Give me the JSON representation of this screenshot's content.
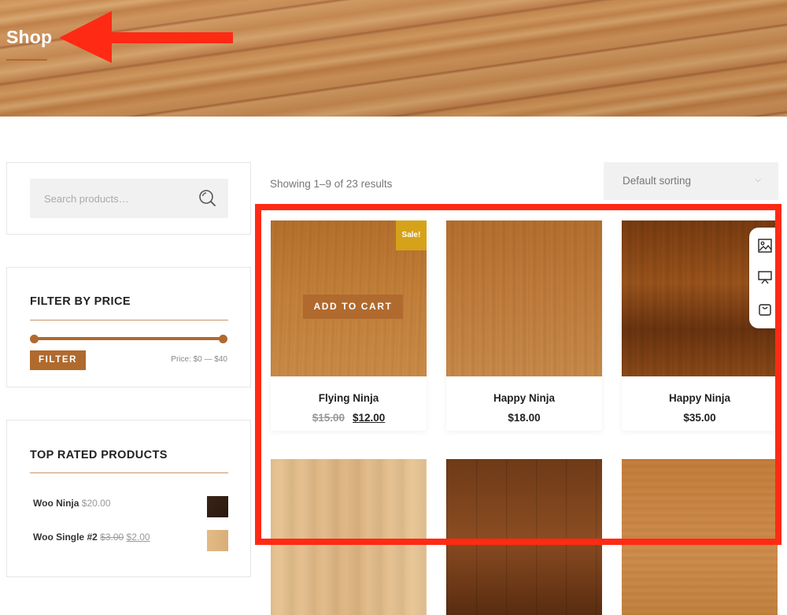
{
  "hero": {
    "title": "Shop"
  },
  "search": {
    "placeholder": "Search products…"
  },
  "filter_price": {
    "title": "FILTER BY PRICE",
    "button_label": "FILTER",
    "range_label": "Price: $0 — $40",
    "min_fraction": 0.0,
    "max_fraction": 1.0
  },
  "top_rated": {
    "title": "TOP RATED PRODUCTS",
    "items": [
      {
        "name": "Woo Ninja",
        "price": "$20.00"
      },
      {
        "name": "Woo Single #2",
        "old_price": "$3.00",
        "new_price": "$2.00"
      }
    ]
  },
  "results": {
    "count_text": "Showing 1–9 of 23 results"
  },
  "sorting": {
    "selected": "Default sorting"
  },
  "products": [
    {
      "name": "Flying Ninja",
      "old_price": "$15.00",
      "price": "$12.00",
      "badge": "Sale!",
      "action": "ADD TO CART"
    },
    {
      "name": "Happy Ninja",
      "price": "$18.00"
    },
    {
      "name": "Happy Ninja",
      "price": "$35.00"
    }
  ],
  "colors": {
    "accent": "#b06a2e",
    "sale_badge": "#d6a21a",
    "annotation": "#ff2a14"
  },
  "icons": {
    "search": "search-icon",
    "chevron": "chevron-down-icon",
    "image_tool": "image-icon",
    "presentation_tool": "presentation-icon",
    "bag_tool": "shopping-bag-icon"
  }
}
